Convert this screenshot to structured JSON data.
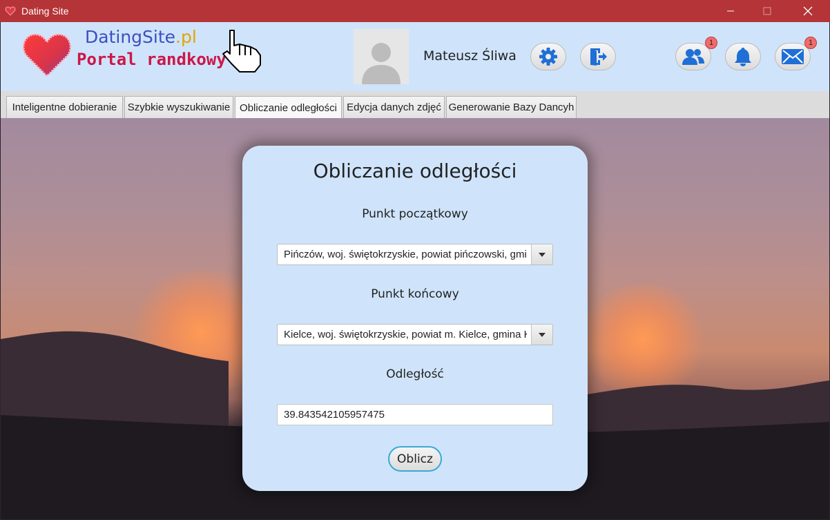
{
  "window": {
    "title": "Dating Site",
    "accent_color": "#b53437",
    "minimize_icon": "minimize-icon",
    "maximize_icon": "maximize-icon",
    "close_icon": "close-icon"
  },
  "header": {
    "logo_title_main": "DatingSite",
    "logo_title_suffix": ".pl",
    "logo_subtitle": "Portal randkowy",
    "user_name": "Mateusz Śliwa",
    "buttons": {
      "settings_icon": "gear-icon",
      "logout_icon": "logout-icon",
      "friends_icon": "users-icon",
      "friends_badge": "1",
      "notifications_icon": "bell-icon",
      "messages_icon": "envelope-icon",
      "messages_badge": "1"
    }
  },
  "tabs": [
    {
      "label": "Inteligentne dobieranie",
      "active": false
    },
    {
      "label": "Szybkie wyszukiwanie",
      "active": false
    },
    {
      "label": "Obliczanie odległości",
      "active": true
    },
    {
      "label": "Edycja danych zdjęć",
      "active": false
    },
    {
      "label": "Generowanie Bazy Dancyh",
      "active": false
    }
  ],
  "panel": {
    "title": "Obliczanie odległości",
    "start_label": "Punkt początkowy",
    "start_value": "Pińczów, woj. świętokrzyskie, powiat pińczowski, gmina Pińczów",
    "end_label": "Punkt końcowy",
    "end_value": "Kielce, woj. świętokrzyskie, powiat m. Kielce, gmina Kielce",
    "distance_label": "Odległość",
    "distance_value": "39.843542105957475",
    "calculate_button": "Oblicz"
  }
}
